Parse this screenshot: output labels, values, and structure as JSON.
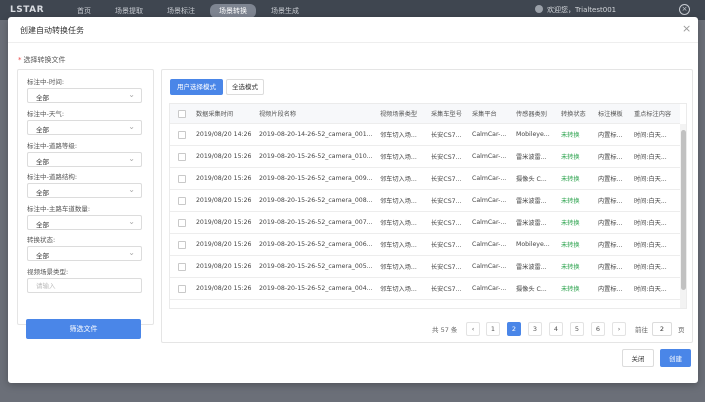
{
  "app": {
    "logo": "LSTAR",
    "nav": [
      "首页",
      "场景提取",
      "场景标注",
      "场景转换",
      "场景生成"
    ],
    "active_nav": 3,
    "user": "欢迎您，Trialtest001"
  },
  "dialog": {
    "title": "创建自动转换任务",
    "section_label": "选择转换文件",
    "close_label": "关闭",
    "create_label": "创建"
  },
  "filters": {
    "items": [
      {
        "label": "标注中-时间:",
        "value": "全部"
      },
      {
        "label": "标注中-天气:",
        "value": "全部"
      },
      {
        "label": "标注中-道路等级:",
        "value": "全部"
      },
      {
        "label": "标注中-道路结构:",
        "value": "全部"
      },
      {
        "label": "标注中-主路车道数量:",
        "value": "全部"
      },
      {
        "label": "转换状态:",
        "value": "全部"
      }
    ],
    "scene_type_label": "视频场景类型:",
    "scene_type_placeholder": "请输入",
    "filter_button": "筛选文件"
  },
  "tabs": {
    "user_mode": "用户选择模式",
    "all_mode": "全选模式"
  },
  "table": {
    "columns": [
      "数据采集时间",
      "视频片段名称",
      "视频场景类型",
      "采集车型号",
      "采集平台",
      "传感器类别",
      "转换状态",
      "标注模板",
      "重点标注内容"
    ],
    "rows": [
      [
        "2019/08/20 14:26",
        "2019-08-20-14-26-52_camera_001...",
        "邻车切入场...",
        "长安CS7...",
        "CalmCar-...",
        "Mobileye...",
        "未转换",
        "内置标...",
        "时间:白天..."
      ],
      [
        "2019/08/20 15:26",
        "2019-08-20-15-26-52_camera_010...",
        "邻车切入场...",
        "长安CS7...",
        "CalmCar-...",
        "雷米波雷...",
        "未转换",
        "内置标...",
        "时间:白天..."
      ],
      [
        "2019/08/20 15:26",
        "2019-08-20-15-26-52_camera_009...",
        "邻车切入场...",
        "长安CS7...",
        "CalmCar-...",
        "摄像头 C...",
        "未转换",
        "内置标...",
        "时间:白天..."
      ],
      [
        "2019/08/20 15:26",
        "2019-08-20-15-26-52_camera_008...",
        "邻车切入场...",
        "长安CS7...",
        "CalmCar-...",
        "雷米波雷...",
        "未转换",
        "内置标...",
        "时间:白天..."
      ],
      [
        "2019/08/20 15:26",
        "2019-08-20-15-26-52_camera_007...",
        "邻车切入场...",
        "长安CS7...",
        "CalmCar-...",
        "雷米波雷...",
        "未转换",
        "内置标...",
        "时间:白天..."
      ],
      [
        "2019/08/20 15:26",
        "2019-08-20-15-26-52_camera_006...",
        "邻车切入场...",
        "长安CS7...",
        "CalmCar-...",
        "Mobileye...",
        "未转换",
        "内置标...",
        "时间:白天..."
      ],
      [
        "2019/08/20 15:26",
        "2019-08-20-15-26-52_camera_005...",
        "邻车切入场...",
        "长安CS7...",
        "CalmCar-...",
        "雷米波雷...",
        "未转换",
        "内置标...",
        "时间:白天..."
      ],
      [
        "2019/08/20 15:26",
        "2019-08-20-15-26-52_camera_004...",
        "邻车切入场...",
        "长安CS7...",
        "CalmCar-...",
        "摄像头 C...",
        "未转换",
        "内置标...",
        "时间:白天..."
      ]
    ]
  },
  "pagination": {
    "total": "共 57 条",
    "pages": [
      "1",
      "2",
      "3",
      "4",
      "5",
      "6"
    ],
    "current": "2",
    "prev": "‹",
    "next": "›",
    "goto_label": "前往",
    "goto_value": "2",
    "unit": "页"
  },
  "icons": {
    "close": "×",
    "chevron": "⌄"
  },
  "colors": {
    "primary": "#4a86e8",
    "status_green": "#2ea44f",
    "required": "#e94848"
  }
}
